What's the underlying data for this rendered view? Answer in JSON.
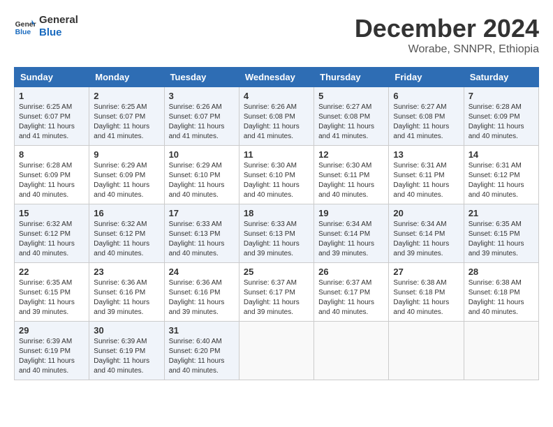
{
  "header": {
    "logo_general": "General",
    "logo_blue": "Blue",
    "month_year": "December 2024",
    "location": "Worabe, SNNPR, Ethiopia"
  },
  "weekdays": [
    "Sunday",
    "Monday",
    "Tuesday",
    "Wednesday",
    "Thursday",
    "Friday",
    "Saturday"
  ],
  "weeks": [
    [
      {
        "day": "1",
        "sunrise": "6:25 AM",
        "sunset": "6:07 PM",
        "daylight": "11 hours and 41 minutes."
      },
      {
        "day": "2",
        "sunrise": "6:25 AM",
        "sunset": "6:07 PM",
        "daylight": "11 hours and 41 minutes."
      },
      {
        "day": "3",
        "sunrise": "6:26 AM",
        "sunset": "6:07 PM",
        "daylight": "11 hours and 41 minutes."
      },
      {
        "day": "4",
        "sunrise": "6:26 AM",
        "sunset": "6:08 PM",
        "daylight": "11 hours and 41 minutes."
      },
      {
        "day": "5",
        "sunrise": "6:27 AM",
        "sunset": "6:08 PM",
        "daylight": "11 hours and 41 minutes."
      },
      {
        "day": "6",
        "sunrise": "6:27 AM",
        "sunset": "6:08 PM",
        "daylight": "11 hours and 41 minutes."
      },
      {
        "day": "7",
        "sunrise": "6:28 AM",
        "sunset": "6:09 PM",
        "daylight": "11 hours and 40 minutes."
      }
    ],
    [
      {
        "day": "8",
        "sunrise": "6:28 AM",
        "sunset": "6:09 PM",
        "daylight": "11 hours and 40 minutes."
      },
      {
        "day": "9",
        "sunrise": "6:29 AM",
        "sunset": "6:09 PM",
        "daylight": "11 hours and 40 minutes."
      },
      {
        "day": "10",
        "sunrise": "6:29 AM",
        "sunset": "6:10 PM",
        "daylight": "11 hours and 40 minutes."
      },
      {
        "day": "11",
        "sunrise": "6:30 AM",
        "sunset": "6:10 PM",
        "daylight": "11 hours and 40 minutes."
      },
      {
        "day": "12",
        "sunrise": "6:30 AM",
        "sunset": "6:11 PM",
        "daylight": "11 hours and 40 minutes."
      },
      {
        "day": "13",
        "sunrise": "6:31 AM",
        "sunset": "6:11 PM",
        "daylight": "11 hours and 40 minutes."
      },
      {
        "day": "14",
        "sunrise": "6:31 AM",
        "sunset": "6:12 PM",
        "daylight": "11 hours and 40 minutes."
      }
    ],
    [
      {
        "day": "15",
        "sunrise": "6:32 AM",
        "sunset": "6:12 PM",
        "daylight": "11 hours and 40 minutes."
      },
      {
        "day": "16",
        "sunrise": "6:32 AM",
        "sunset": "6:12 PM",
        "daylight": "11 hours and 40 minutes."
      },
      {
        "day": "17",
        "sunrise": "6:33 AM",
        "sunset": "6:13 PM",
        "daylight": "11 hours and 40 minutes."
      },
      {
        "day": "18",
        "sunrise": "6:33 AM",
        "sunset": "6:13 PM",
        "daylight": "11 hours and 39 minutes."
      },
      {
        "day": "19",
        "sunrise": "6:34 AM",
        "sunset": "6:14 PM",
        "daylight": "11 hours and 39 minutes."
      },
      {
        "day": "20",
        "sunrise": "6:34 AM",
        "sunset": "6:14 PM",
        "daylight": "11 hours and 39 minutes."
      },
      {
        "day": "21",
        "sunrise": "6:35 AM",
        "sunset": "6:15 PM",
        "daylight": "11 hours and 39 minutes."
      }
    ],
    [
      {
        "day": "22",
        "sunrise": "6:35 AM",
        "sunset": "6:15 PM",
        "daylight": "11 hours and 39 minutes."
      },
      {
        "day": "23",
        "sunrise": "6:36 AM",
        "sunset": "6:16 PM",
        "daylight": "11 hours and 39 minutes."
      },
      {
        "day": "24",
        "sunrise": "6:36 AM",
        "sunset": "6:16 PM",
        "daylight": "11 hours and 39 minutes."
      },
      {
        "day": "25",
        "sunrise": "6:37 AM",
        "sunset": "6:17 PM",
        "daylight": "11 hours and 39 minutes."
      },
      {
        "day": "26",
        "sunrise": "6:37 AM",
        "sunset": "6:17 PM",
        "daylight": "11 hours and 40 minutes."
      },
      {
        "day": "27",
        "sunrise": "6:38 AM",
        "sunset": "6:18 PM",
        "daylight": "11 hours and 40 minutes."
      },
      {
        "day": "28",
        "sunrise": "6:38 AM",
        "sunset": "6:18 PM",
        "daylight": "11 hours and 40 minutes."
      }
    ],
    [
      {
        "day": "29",
        "sunrise": "6:39 AM",
        "sunset": "6:19 PM",
        "daylight": "11 hours and 40 minutes."
      },
      {
        "day": "30",
        "sunrise": "6:39 AM",
        "sunset": "6:19 PM",
        "daylight": "11 hours and 40 minutes."
      },
      {
        "day": "31",
        "sunrise": "6:40 AM",
        "sunset": "6:20 PM",
        "daylight": "11 hours and 40 minutes."
      },
      null,
      null,
      null,
      null
    ]
  ]
}
